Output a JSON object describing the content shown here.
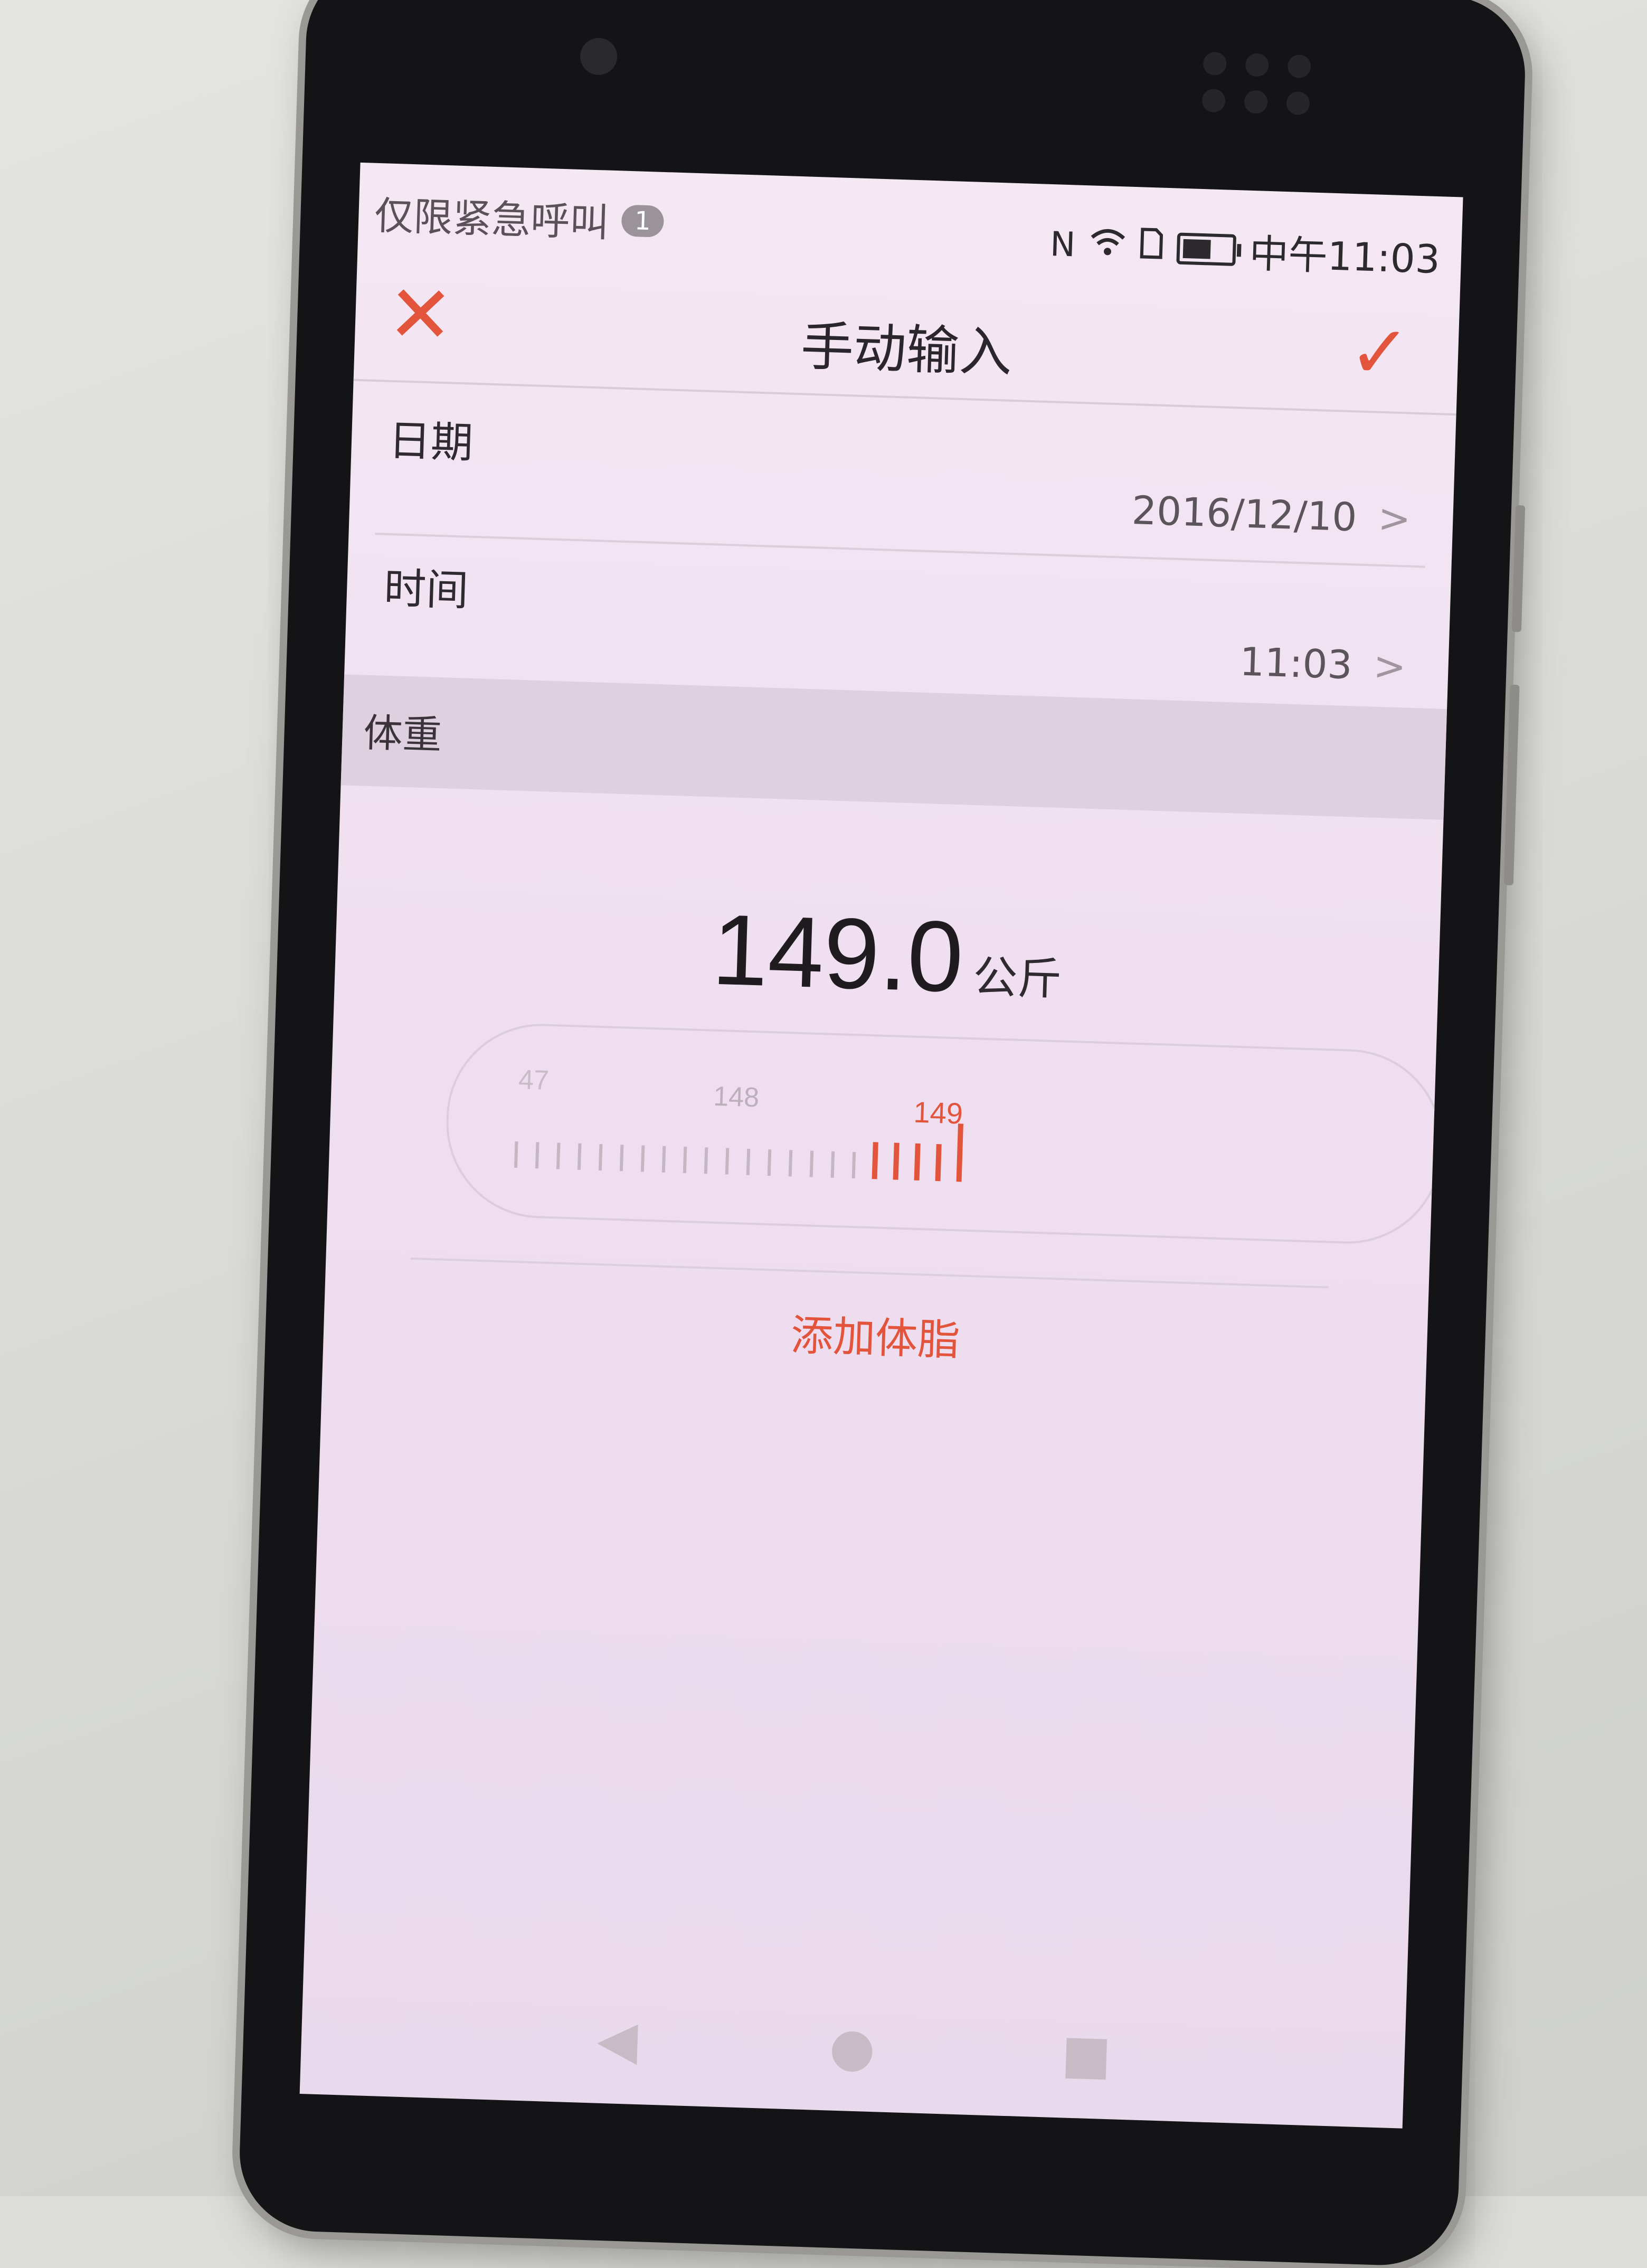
{
  "status_bar": {
    "carrier": "仅限紧急呼叫",
    "notification_count": "1",
    "time": "中午11:03"
  },
  "header": {
    "title": "手动输入"
  },
  "form": {
    "date_label": "日期",
    "date_value": "2016/12/10",
    "time_label": "时间",
    "time_value": "11:03",
    "section_label": "体重"
  },
  "weight": {
    "value": "149.0",
    "unit": "公斤",
    "ruler_labels": [
      "47",
      "148",
      "149"
    ]
  },
  "actions": {
    "add_body_fat": "添加体脂"
  },
  "colors": {
    "accent": "#e2553c",
    "background": "#f1e3f1"
  }
}
